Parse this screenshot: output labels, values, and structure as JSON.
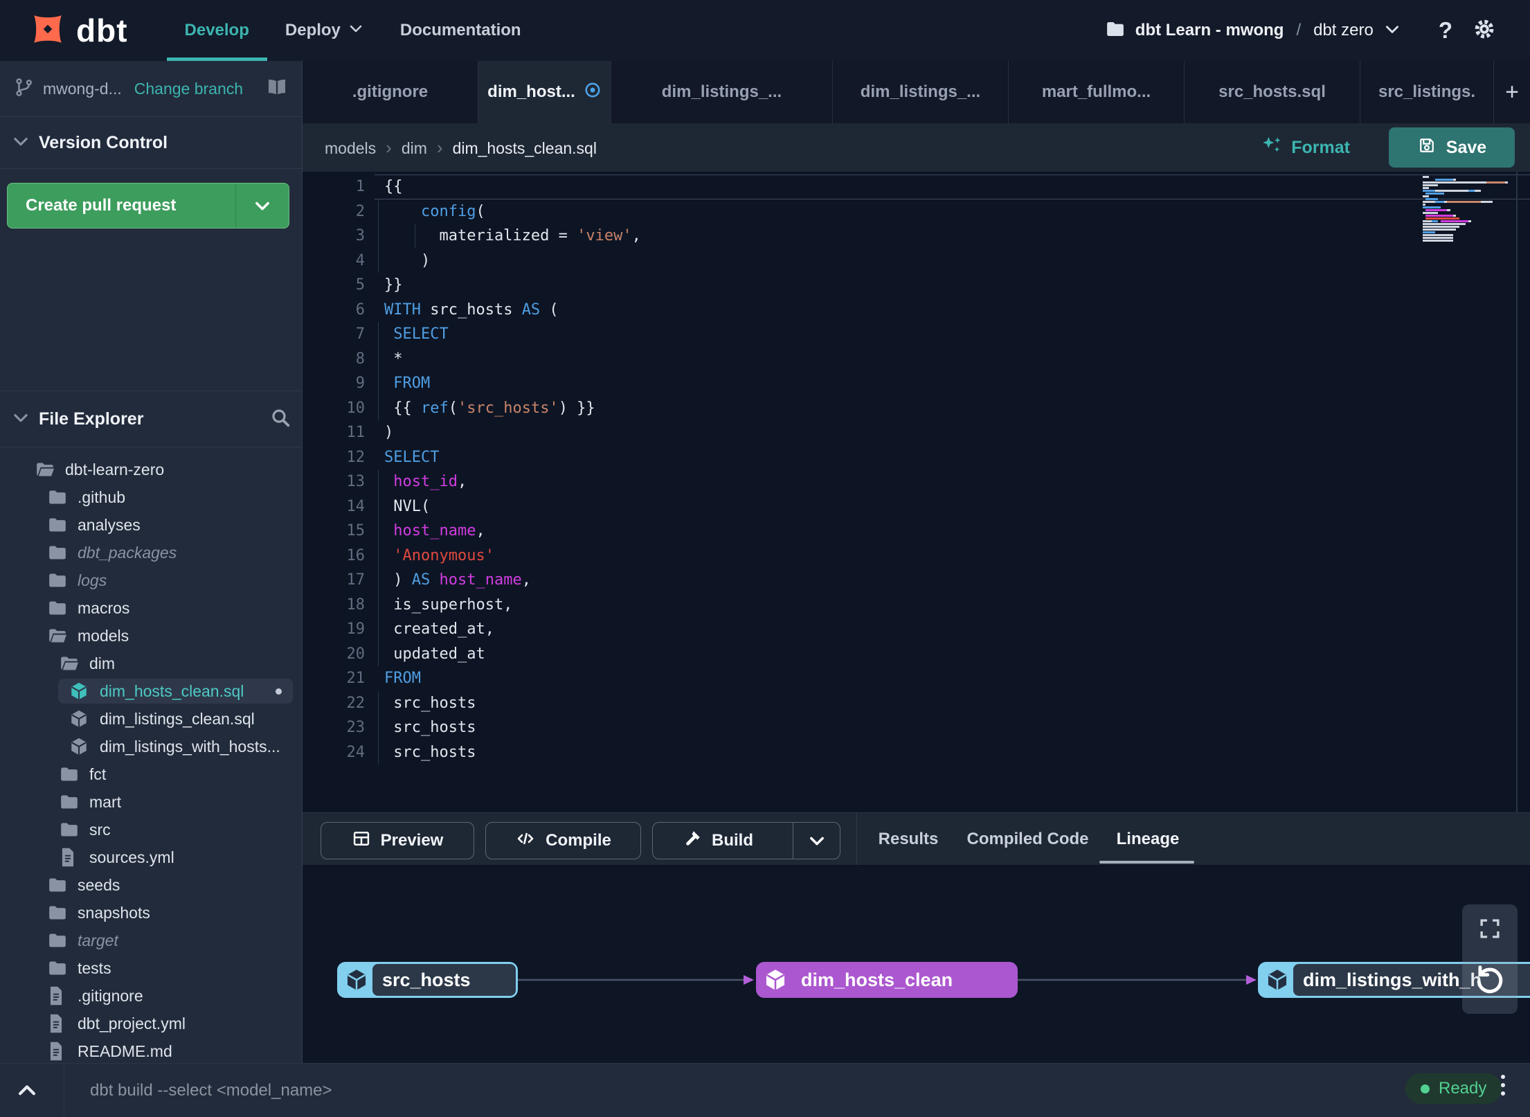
{
  "topbar": {
    "logo_text": "dbt",
    "nav": {
      "develop": "Develop",
      "deploy": "Deploy",
      "documentation": "Documentation"
    },
    "project": {
      "name": "dbt Learn - mwong",
      "separator": "/",
      "environment": "dbt zero"
    },
    "help_label": "?"
  },
  "sidebar": {
    "branch": {
      "name": "mwong-d...",
      "change_link": "Change branch"
    },
    "version_control": {
      "title": "Version Control",
      "create_pr_label": "Create pull request"
    },
    "file_explorer": {
      "title": "File Explorer",
      "tree": [
        {
          "name": "dbt-learn-zero",
          "icon": "folder-open",
          "level": 0
        },
        {
          "name": ".github",
          "icon": "folder",
          "level": 1
        },
        {
          "name": "analyses",
          "icon": "folder",
          "level": 1
        },
        {
          "name": "dbt_packages",
          "icon": "folder",
          "level": 1,
          "italic": true
        },
        {
          "name": "logs",
          "icon": "folder",
          "level": 1,
          "italic": true
        },
        {
          "name": "macros",
          "icon": "folder",
          "level": 1
        },
        {
          "name": "models",
          "icon": "folder-open",
          "level": 1
        },
        {
          "name": "dim",
          "icon": "folder-open",
          "level": 2
        },
        {
          "name": "dim_hosts_clean.sql",
          "icon": "model",
          "level": 3,
          "selected": true,
          "modified": true
        },
        {
          "name": "dim_listings_clean.sql",
          "icon": "model",
          "level": 3
        },
        {
          "name": "dim_listings_with_hosts...",
          "icon": "model",
          "level": 3
        },
        {
          "name": "fct",
          "icon": "folder",
          "level": 2
        },
        {
          "name": "mart",
          "icon": "folder",
          "level": 2
        },
        {
          "name": "src",
          "icon": "folder",
          "level": 2
        },
        {
          "name": "sources.yml",
          "icon": "file",
          "level": 2
        },
        {
          "name": "seeds",
          "icon": "folder",
          "level": 1
        },
        {
          "name": "snapshots",
          "icon": "folder",
          "level": 1
        },
        {
          "name": "target",
          "icon": "folder",
          "level": 1,
          "italic": true
        },
        {
          "name": "tests",
          "icon": "folder",
          "level": 1
        },
        {
          "name": ".gitignore",
          "icon": "file",
          "level": 1
        },
        {
          "name": "dbt_project.yml",
          "icon": "file",
          "level": 1
        },
        {
          "name": "README.md",
          "icon": "file",
          "level": 1
        }
      ]
    }
  },
  "tabbar": {
    "tabs": [
      {
        "label": ".gitignore"
      },
      {
        "label": "dim_host...",
        "active": true,
        "modified": true
      },
      {
        "label": "dim_listings_..."
      },
      {
        "label": "dim_listings_..."
      },
      {
        "label": "mart_fullmo..."
      },
      {
        "label": "src_hosts.sql"
      },
      {
        "label": "src_listings."
      }
    ],
    "add_tab": "+"
  },
  "breadcrumb": {
    "items": [
      "models",
      "dim",
      "dim_hosts_clean.sql"
    ]
  },
  "editor_toolbar": {
    "format_label": "Format",
    "save_label": "Save"
  },
  "editor": {
    "lines": [
      {
        "n": 1,
        "current": true,
        "guides": [],
        "tokens": [
          [
            "p",
            "{{"
          ]
        ]
      },
      {
        "n": 2,
        "guides": [
          0
        ],
        "tokens": [
          [
            "p",
            "    "
          ],
          [
            "k",
            "config"
          ],
          [
            "p",
            "("
          ]
        ]
      },
      {
        "n": 3,
        "guides": [
          0,
          4
        ],
        "tokens": [
          [
            "p",
            "      materialized = "
          ],
          [
            "s",
            "'view'"
          ],
          [
            "p",
            ","
          ]
        ]
      },
      {
        "n": 4,
        "guides": [
          0
        ],
        "tokens": [
          [
            "p",
            "    )"
          ]
        ]
      },
      {
        "n": 5,
        "guides": [],
        "tokens": [
          [
            "p",
            "}}"
          ]
        ]
      },
      {
        "n": 6,
        "guides": [],
        "tokens": [
          [
            "k",
            "WITH"
          ],
          [
            "p",
            " src_hosts "
          ],
          [
            "k",
            "AS"
          ],
          [
            "p",
            " ("
          ]
        ]
      },
      {
        "n": 7,
        "guides": [
          0
        ],
        "tokens": [
          [
            "p",
            " "
          ],
          [
            "k",
            "SELECT"
          ]
        ]
      },
      {
        "n": 8,
        "guides": [
          0
        ],
        "tokens": [
          [
            "p",
            " *"
          ]
        ]
      },
      {
        "n": 9,
        "guides": [
          0
        ],
        "tokens": [
          [
            "p",
            " "
          ],
          [
            "k",
            "FROM"
          ]
        ]
      },
      {
        "n": 10,
        "guides": [
          0
        ],
        "tokens": [
          [
            "p",
            " {{ "
          ],
          [
            "k",
            "ref"
          ],
          [
            "p",
            "("
          ],
          [
            "s",
            "'src_hosts'"
          ],
          [
            "p",
            ") }}"
          ]
        ]
      },
      {
        "n": 11,
        "guides": [],
        "tokens": [
          [
            "p",
            ")"
          ]
        ]
      },
      {
        "n": 12,
        "guides": [],
        "tokens": [
          [
            "k",
            "SELECT"
          ]
        ]
      },
      {
        "n": 13,
        "guides": [
          0
        ],
        "tokens": [
          [
            "p",
            " "
          ],
          [
            "m",
            "host_id"
          ],
          [
            "p",
            ","
          ]
        ]
      },
      {
        "n": 14,
        "guides": [
          0
        ],
        "tokens": [
          [
            "p",
            " NVL("
          ]
        ]
      },
      {
        "n": 15,
        "guides": [
          0
        ],
        "tokens": [
          [
            "p",
            " "
          ],
          [
            "m",
            "host_name"
          ],
          [
            "p",
            ","
          ]
        ]
      },
      {
        "n": 16,
        "guides": [
          0
        ],
        "tokens": [
          [
            "p",
            " "
          ],
          [
            "r",
            "'Anonymous'"
          ]
        ]
      },
      {
        "n": 17,
        "guides": [
          0
        ],
        "tokens": [
          [
            "p",
            " ) "
          ],
          [
            "k",
            "AS"
          ],
          [
            "p",
            " "
          ],
          [
            "m",
            "host_name"
          ],
          [
            "p",
            ","
          ]
        ]
      },
      {
        "n": 18,
        "guides": [
          0
        ],
        "tokens": [
          [
            "p",
            " is_superhost,"
          ]
        ]
      },
      {
        "n": 19,
        "guides": [
          0
        ],
        "tokens": [
          [
            "p",
            " created_at,"
          ]
        ]
      },
      {
        "n": 20,
        "guides": [
          0
        ],
        "tokens": [
          [
            "p",
            " updated_at"
          ]
        ]
      },
      {
        "n": 21,
        "guides": [],
        "tokens": [
          [
            "k",
            "FROM"
          ]
        ]
      },
      {
        "n": 22,
        "guides": [
          0
        ],
        "tokens": [
          [
            "p",
            " src_hosts"
          ]
        ]
      },
      {
        "n": 23,
        "guides": [
          0
        ],
        "tokens": [
          [
            "p",
            " src_hosts"
          ]
        ]
      },
      {
        "n": 24,
        "guides": [
          0
        ],
        "tokens": [
          [
            "p",
            " src_hosts"
          ]
        ]
      }
    ]
  },
  "result_panel": {
    "buttons": {
      "preview": "Preview",
      "compile": "Compile",
      "build": "Build"
    },
    "tabs": [
      {
        "label": "Results"
      },
      {
        "label": "Compiled Code"
      },
      {
        "label": "Lineage",
        "active": true
      }
    ]
  },
  "lineage": {
    "nodes": [
      {
        "label": "src_hosts",
        "type": "source"
      },
      {
        "label": "dim_hosts_clean",
        "type": "model"
      },
      {
        "label": "dim_listings_with_h",
        "type": "source"
      }
    ]
  },
  "statusbar": {
    "command_placeholder": "dbt build --select <model_name>",
    "status_label": "Ready"
  },
  "colors": {
    "accent_teal": "#3cb5b0",
    "logo_orange": "#ff6a4c",
    "button_green": "#3d9d5d",
    "save_teal": "#2e7471",
    "node_purple": "#ab57cf",
    "node_cyan": "#82cfee",
    "status_green": "#52d191",
    "keyword_blue": "#509ee3",
    "string_salmon": "#c9846a",
    "string_red": "#e0493f",
    "identifier_magenta": "#d13ce0"
  }
}
